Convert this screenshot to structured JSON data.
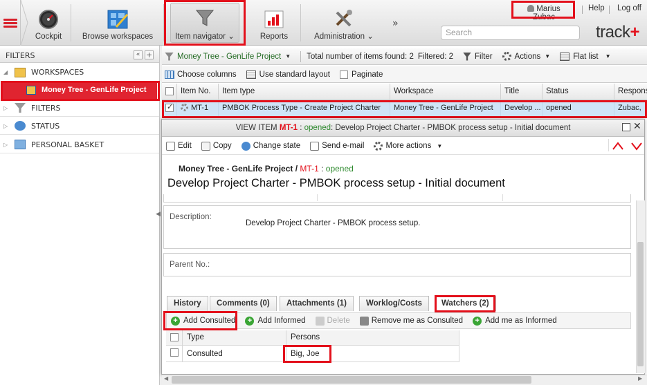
{
  "nav": {
    "cockpit": "Cockpit",
    "browse_workspaces": "Browse workspaces",
    "item_navigator": "Item navigator",
    "reports": "Reports",
    "administration": "Administration",
    "more": "»"
  },
  "user": {
    "name": "Marius Zubac",
    "help": "Help",
    "logoff": "Log off"
  },
  "search": {
    "placeholder": "Search"
  },
  "logo": {
    "text": "track",
    "plus": "+"
  },
  "filters": {
    "header": "FILTERS",
    "workspaces": "WORKSPACES",
    "selected_project": "Money Tree - GenLife Project",
    "filters": "FILTERS",
    "status": "STATUS",
    "personal_basket": "PERSONAL BASKET"
  },
  "toolbar": {
    "project": "Money Tree - GenLife Project",
    "total": "Total number of items found: 2",
    "filtered": "Filtered: 2",
    "filter": "Filter",
    "actions": "Actions",
    "flat_list": "Flat list",
    "choose_columns": "Choose columns",
    "standard_layout": "Use standard layout",
    "paginate": "Paginate"
  },
  "grid": {
    "headers": [
      "Item No.",
      "Item type",
      "Workspace",
      "Title",
      "Status",
      "Respons"
    ],
    "row": [
      "MT-1",
      "PMBOK Process Type - Create Project Charter",
      "Money Tree - GenLife Project",
      "Develop ...",
      "opened",
      "Zubac,"
    ]
  },
  "view": {
    "title_prefix": "VIEW ITEM",
    "item_id": "MT-1",
    "sep": ":",
    "status": "opened",
    "title": ": Develop Project Charter - PMBOK process setup - Initial document",
    "edit": "Edit",
    "copy": "Copy",
    "change_state": "Change state",
    "send_email": "Send e-mail",
    "more_actions": "More actions",
    "project": "Money Tree - GenLife Project",
    "slash": "/",
    "heading": "Develop Project Charter - PMBOK process setup - Initial document",
    "description_label": "Description:",
    "description": "Develop Project Charter - PMBOK process setup.",
    "parent_label": "Parent No.:"
  },
  "tabs": {
    "history": "History",
    "comments": "Comments (0)",
    "attachments": "Attachments (1)",
    "worklog": "Worklog/Costs",
    "watchers": "Watchers (2)"
  },
  "watchers": {
    "add_consulted": "Add Consulted",
    "add_informed": "Add Informed",
    "delete": "Delete",
    "remove_consulted": "Remove me as Consulted",
    "add_me_informed": "Add me as Informed",
    "col_type": "Type",
    "col_persons": "Persons",
    "row_type": "Consulted",
    "row_person": "Big, Joe"
  },
  "colors": {
    "accent": "#e3101b",
    "selection": "#cfe4f7",
    "status_green": "#2f8a2f"
  }
}
